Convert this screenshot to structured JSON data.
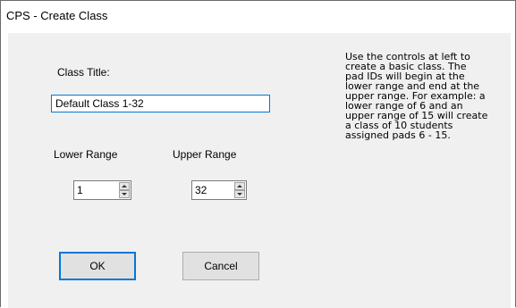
{
  "window": {
    "title": "CPS - Create Class"
  },
  "form": {
    "class_title_label": "Class Title:",
    "class_title_value": "Default Class 1-32",
    "lower_range_label": "Lower Range",
    "upper_range_label": "Upper Range",
    "lower_range_value": "1",
    "upper_range_value": "32"
  },
  "buttons": {
    "ok_label": "OK",
    "cancel_label": "Cancel"
  },
  "help": {
    "lines": [
      "Use the controls at left to",
      "create a basic class. The",
      "pad IDs will begin at the",
      "lower range and end at the",
      "upper range. For example: a",
      "lower range of 6 and an",
      "upper range of 15 will create",
      "a class of 10 students",
      "assigned pads 6 - 15."
    ]
  },
  "colors": {
    "focus_border": "#0078d7",
    "dialog_background": "#f0f0f0"
  }
}
